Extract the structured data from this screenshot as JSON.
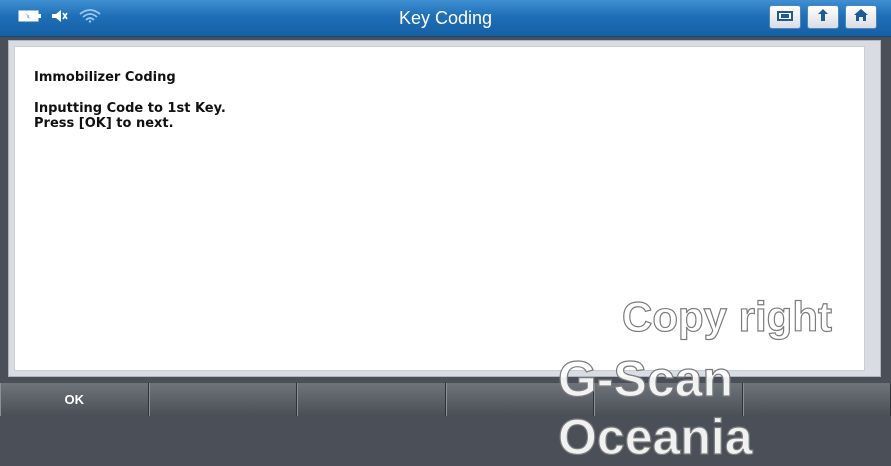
{
  "header": {
    "title": "Key Coding",
    "status_icons": [
      "battery-icon",
      "speaker-icon",
      "wifi-icon"
    ],
    "buttons": [
      "screen-icon",
      "back-icon",
      "home-icon"
    ]
  },
  "message": {
    "heading": "Immobilizer Coding",
    "line1": "Inputting Code to 1st Key.",
    "line2": "Press [OK] to next."
  },
  "footer": {
    "buttons": [
      "OK",
      "",
      "",
      "",
      "",
      ""
    ]
  },
  "watermark": {
    "line1": "Copy right",
    "line2": "G-Scan Oceania"
  },
  "colors": {
    "header_blue": "#1e6fb8",
    "footer_gray": "#54595f",
    "content_bg": "#ffffff"
  }
}
